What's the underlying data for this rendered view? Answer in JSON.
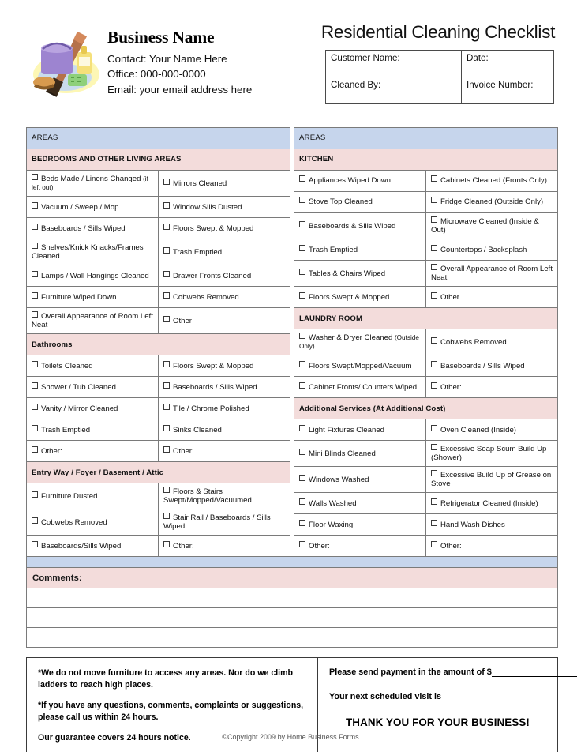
{
  "header": {
    "business_name": "Business Name",
    "contact_line": "Contact:  Your Name Here",
    "office_line": "Office:  000-000-0000",
    "email_line": "Email:  your email address here",
    "logo_icon": "cleaning-supplies-icon",
    "doc_title": "Residential Cleaning Checklist",
    "customer_info": [
      {
        "left": "Customer Name:",
        "right": "Date:"
      },
      {
        "left": "Cleaned By:",
        "right": "Invoice Number:"
      }
    ]
  },
  "left_column": {
    "areas_header": "AREAS",
    "sections": [
      {
        "title": "BEDROOMS AND OTHER LIVING AREAS",
        "split": 198,
        "rows": [
          {
            "left": "Beds Made / Linens Changed",
            "left_small": "(if left out)",
            "right": "Mirrors Cleaned"
          },
          {
            "left": "Vacuum / Sweep / Mop",
            "right": "Window Sills Dusted"
          },
          {
            "left": "Baseboards / Sills Wiped",
            "right": "Floors Swept & Mopped"
          },
          {
            "left": "Shelves/Knick Knacks/Frames Cleaned",
            "right": "Trash Emptied"
          },
          {
            "left": "Lamps / Wall Hangings Cleaned",
            "right": "Drawer Fronts Cleaned"
          },
          {
            "left": "Furniture Wiped Down",
            "right": "Cobwebs Removed"
          },
          {
            "left": "Overall Appearance of Room Left Neat",
            "right": "Other"
          }
        ]
      },
      {
        "title": "Bathrooms",
        "split": 131,
        "rows": [
          {
            "left": "Toilets Cleaned",
            "right": "Floors Swept & Mopped"
          },
          {
            "left": "Shower / Tub Cleaned",
            "right": "Baseboards / Sills Wiped"
          },
          {
            "left": "Vanity / Mirror Cleaned",
            "right": "Tile / Chrome Polished"
          },
          {
            "left": "Trash Emptied",
            "right": "Sinks Cleaned"
          },
          {
            "left": "Other:",
            "right": "Other:"
          }
        ]
      },
      {
        "title": "Entry Way / Foyer / Basement / Attic",
        "split": 131,
        "rows": [
          {
            "left": "Furniture Dusted",
            "right": "Floors & Stairs Swept/Mopped/Vacuumed"
          },
          {
            "left": "Cobwebs Removed",
            "right": "Stair Rail / Baseboards / Sills Wiped"
          },
          {
            "left": "Baseboards/Sills Wiped",
            "right": "Other:"
          }
        ]
      }
    ]
  },
  "right_column": {
    "areas_header": "AREAS",
    "sections": [
      {
        "title": "KITCHEN",
        "split": 136,
        "rows": [
          {
            "left": "Appliances Wiped Down",
            "right": "Cabinets Cleaned (Fronts Only)"
          },
          {
            "left": "Stove Top Cleaned",
            "right": "Fridge Cleaned (Outside Only)"
          },
          {
            "left": "Baseboards & Sills Wiped",
            "right": "Microwave Cleaned (Inside & Out)"
          },
          {
            "left": "Trash Emptied",
            "right": "Countertops / Backsplash"
          },
          {
            "left": "Tables & Chairs Wiped",
            "right": "Overall Appearance of Room Left Neat"
          },
          {
            "left": "Floors Swept & Mopped",
            "right": "Other"
          }
        ]
      },
      {
        "title": "LAUNDRY ROOM",
        "split": 196,
        "rows": [
          {
            "left": "Washer & Dryer Cleaned",
            "left_small": "(Outside Only)",
            "right": "Cobwebs Removed"
          },
          {
            "left": "Floors Swept/Mopped/Vacuum",
            "right": "Baseboards / Sills Wiped"
          },
          {
            "left": "Cabinet Fronts/ Counters Wiped",
            "right": "Other:"
          }
        ]
      },
      {
        "title": "Additional Services (At Additional Cost)",
        "split": 137,
        "rows": [
          {
            "left": "Light Fixtures Cleaned",
            "right": "Oven Cleaned (Inside)"
          },
          {
            "left": "Mini Blinds Cleaned",
            "right": "Excessive Soap Scum Build Up (Shower)"
          },
          {
            "left": "Windows Washed",
            "right": "Excessive Build Up of Grease on Stove"
          },
          {
            "left": "Walls Washed",
            "right": "Refrigerator Cleaned (Inside)"
          },
          {
            "left": "Floor Waxing",
            "right": "Hand Wash Dishes"
          },
          {
            "left": "Other:",
            "right": "Other:"
          }
        ]
      }
    ]
  },
  "comments": {
    "label": "Comments:",
    "blank_lines": 3
  },
  "footer": {
    "disclaimers": [
      "*We do not move furniture to access any areas.  Nor do we climb ladders to reach high places.",
      "*If you have any questions, comments, complaints or suggestions, please call us within 24 hours.",
      "Our guarantee covers 24 hours notice."
    ],
    "payment_label": "Please send payment in the amount of $",
    "visit_label": "Your next scheduled visit is",
    "thank_you": "THANK YOU FOR YOUR BUSINESS!"
  },
  "copyright": "©Copyright 2009 by Home Business Forms",
  "colors": {
    "areas_bar": "#c6d5ec",
    "section_bar": "#f3dcdb",
    "border": "#7a7a7a"
  }
}
